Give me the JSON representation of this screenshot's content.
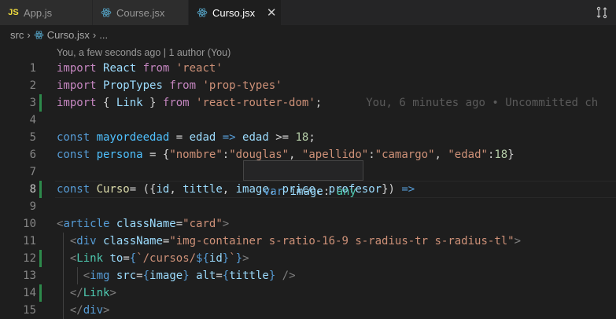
{
  "tabs": [
    {
      "label": "App.js",
      "icon": "js-icon",
      "badge": "JS"
    },
    {
      "label": "Course.jsx",
      "icon": "react-icon"
    },
    {
      "label": "Curso.jsx",
      "icon": "react-icon",
      "active": true
    }
  ],
  "breadcrumb": {
    "folder": "src",
    "file": "Curso.jsx",
    "more": "..."
  },
  "codelens": "You, a few seconds ago | 1 author (You)",
  "hover": {
    "keyword": "var",
    "name": "image",
    "type": "any"
  },
  "blame": "You, 6 minutes ago • Uncommitted ch",
  "line_numbers": [
    "1",
    "2",
    "3",
    "4",
    "5",
    "6",
    "7",
    "8",
    "9",
    "10",
    "11",
    "12",
    "13",
    "14",
    "15"
  ],
  "current_line": "8",
  "colors": {
    "accent": "#569cd6",
    "background": "#1e1e1e",
    "git_added": "#2d8a4b"
  },
  "lines": [
    [
      {
        "c": "kp",
        "t": "import "
      },
      {
        "c": "v2",
        "t": "React "
      },
      {
        "c": "kp",
        "t": "from "
      },
      {
        "c": "s",
        "t": "'react'"
      }
    ],
    [
      {
        "c": "kp",
        "t": "import "
      },
      {
        "c": "v2",
        "t": "PropTypes "
      },
      {
        "c": "kp",
        "t": "from "
      },
      {
        "c": "s",
        "t": "'prop-types'"
      }
    ],
    [
      {
        "c": "kp",
        "t": "import "
      },
      {
        "c": "p",
        "t": "{ "
      },
      {
        "c": "v2",
        "t": "Link "
      },
      {
        "c": "p",
        "t": "} "
      },
      {
        "c": "kp",
        "t": "from "
      },
      {
        "c": "s",
        "t": "'react-router-dom'"
      },
      {
        "c": "p",
        "t": ";"
      }
    ],
    [],
    [
      {
        "c": "k",
        "t": "const "
      },
      {
        "c": "v",
        "t": "mayordeedad "
      },
      {
        "c": "p",
        "t": "= "
      },
      {
        "c": "v2",
        "t": "edad "
      },
      {
        "c": "k",
        "t": "=> "
      },
      {
        "c": "v2",
        "t": "edad "
      },
      {
        "c": "p",
        "t": ">= "
      },
      {
        "c": "n",
        "t": "18"
      },
      {
        "c": "p",
        "t": ";"
      }
    ],
    [
      {
        "c": "k",
        "t": "const "
      },
      {
        "c": "v",
        "t": "persona "
      },
      {
        "c": "p",
        "t": "= {"
      },
      {
        "c": "s",
        "t": "\"nombre\""
      },
      {
        "c": "p",
        "t": ":"
      },
      {
        "c": "s",
        "t": "\"douglas\""
      },
      {
        "c": "p",
        "t": ", "
      },
      {
        "c": "s",
        "t": "\"apellido\""
      },
      {
        "c": "p",
        "t": ":"
      },
      {
        "c": "s",
        "t": "\"camargo\""
      },
      {
        "c": "p",
        "t": ", "
      },
      {
        "c": "s",
        "t": "\"edad\""
      },
      {
        "c": "p",
        "t": ":"
      },
      {
        "c": "n",
        "t": "18"
      },
      {
        "c": "p",
        "t": "}"
      }
    ],
    [],
    [
      {
        "c": "k",
        "t": "const "
      },
      {
        "c": "f",
        "t": "Curso"
      },
      {
        "c": "p",
        "t": "= ({"
      },
      {
        "c": "v2",
        "t": "id"
      },
      {
        "c": "p",
        "t": ", "
      },
      {
        "c": "v2",
        "t": "tittle"
      },
      {
        "c": "p",
        "t": ", "
      },
      {
        "c": "v2",
        "t": "image"
      },
      {
        "c": "p",
        "t": ", "
      },
      {
        "c": "v2",
        "t": "price"
      },
      {
        "c": "p",
        "t": ", "
      },
      {
        "c": "v2",
        "t": "profesor"
      },
      {
        "c": "p",
        "t": "}) "
      },
      {
        "c": "k",
        "t": "=>"
      }
    ],
    [],
    [
      {
        "c": "g",
        "t": "<"
      },
      {
        "c": "k",
        "t": "article "
      },
      {
        "c": "a",
        "t": "className"
      },
      {
        "c": "p",
        "t": "="
      },
      {
        "c": "s",
        "t": "\"card\""
      },
      {
        "c": "g",
        "t": ">"
      }
    ],
    [
      {
        "c": "p",
        "t": "  "
      },
      {
        "c": "g",
        "t": "<"
      },
      {
        "c": "k",
        "t": "div "
      },
      {
        "c": "a",
        "t": "className"
      },
      {
        "c": "p",
        "t": "="
      },
      {
        "c": "s",
        "t": "\"img-container s-ratio-16-9 s-radius-tr s-radius-tl\""
      },
      {
        "c": "g",
        "t": ">"
      }
    ],
    [
      {
        "c": "p",
        "t": "  "
      },
      {
        "c": "g",
        "t": "<"
      },
      {
        "c": "t",
        "t": "Link "
      },
      {
        "c": "a",
        "t": "to"
      },
      {
        "c": "p",
        "t": "="
      },
      {
        "c": "k",
        "t": "{"
      },
      {
        "c": "s",
        "t": "`/cursos/"
      },
      {
        "c": "k",
        "t": "${"
      },
      {
        "c": "v2",
        "t": "id"
      },
      {
        "c": "k",
        "t": "}"
      },
      {
        "c": "s",
        "t": "`"
      },
      {
        "c": "k",
        "t": "}"
      },
      {
        "c": "g",
        "t": ">"
      }
    ],
    [
      {
        "c": "p",
        "t": "    "
      },
      {
        "c": "g",
        "t": "<"
      },
      {
        "c": "k",
        "t": "img "
      },
      {
        "c": "a",
        "t": "src"
      },
      {
        "c": "p",
        "t": "="
      },
      {
        "c": "k",
        "t": "{"
      },
      {
        "c": "v2",
        "t": "image"
      },
      {
        "c": "k",
        "t": "} "
      },
      {
        "c": "a",
        "t": "alt"
      },
      {
        "c": "p",
        "t": "="
      },
      {
        "c": "k",
        "t": "{"
      },
      {
        "c": "v2",
        "t": "tittle"
      },
      {
        "c": "k",
        "t": "} "
      },
      {
        "c": "g",
        "t": "/>"
      }
    ],
    [
      {
        "c": "p",
        "t": "  "
      },
      {
        "c": "g",
        "t": "</"
      },
      {
        "c": "t",
        "t": "Link"
      },
      {
        "c": "g",
        "t": ">"
      }
    ],
    [
      {
        "c": "p",
        "t": "  "
      },
      {
        "c": "g",
        "t": "</"
      },
      {
        "c": "k",
        "t": "div"
      },
      {
        "c": "g",
        "t": ">"
      }
    ]
  ]
}
